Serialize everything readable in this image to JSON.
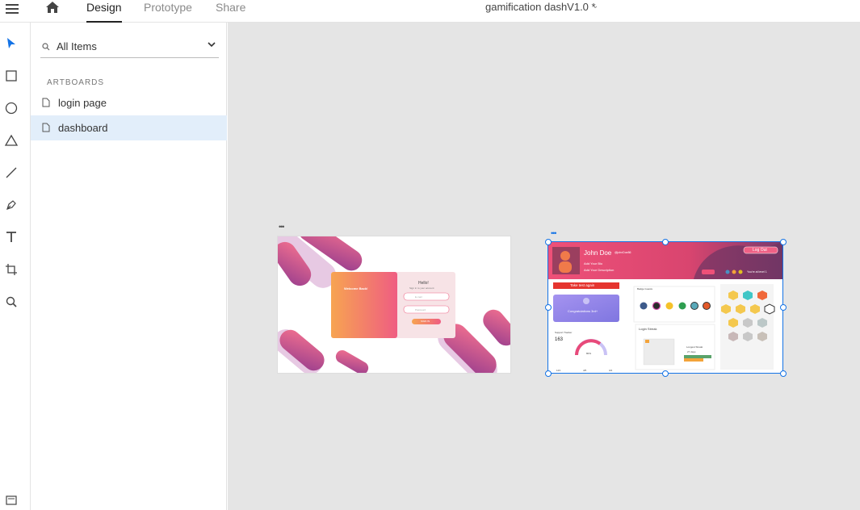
{
  "app": {
    "tabs": [
      {
        "label": "Design",
        "active": true
      },
      {
        "label": "Prototype",
        "active": false
      },
      {
        "label": "Share",
        "active": false
      }
    ],
    "document_title": "gamification dashV1.0 *"
  },
  "tools": [
    "select-icon",
    "rectangle-icon",
    "ellipse-icon",
    "triangle-icon",
    "line-icon",
    "pen-icon",
    "text-icon",
    "artboard-icon",
    "zoom-icon"
  ],
  "layers_panel": {
    "filter_value": "All Items",
    "section_title": "ARTBOARDS",
    "items": [
      {
        "label": "login page",
        "selected": false
      },
      {
        "label": "dashboard",
        "selected": true
      }
    ]
  },
  "canvas": {
    "login_artboard": {
      "welcome": "Welcome Back!",
      "hello": "Hello!",
      "subtitle": "Sign in to your account",
      "email_placeholder": "E-mail",
      "password_placeholder": "Password",
      "signin": "SIGN IN"
    },
    "dashboard_artboard": {
      "user_name": "John Doe",
      "handle": "@johnDoe86",
      "bio": "Add Your Bio",
      "description": "Add Your Description",
      "logout": "Log Out",
      "level_text": "You're at level 1",
      "take_test": "Take test again",
      "congrats": "Congratulations 3rd+",
      "badges_title": "Badge Guests",
      "support_title": "Support Tracker",
      "support_value": "163",
      "login_streak": "Login Streak",
      "longest": "Longest Streak",
      "longest_value": "27 days",
      "percent": "80%",
      "stats": [
        "123",
        "4/5",
        "3/4"
      ]
    }
  },
  "colors": {
    "accent": "#1473e6",
    "pink": "#e8457a",
    "orange": "#f7a451"
  }
}
